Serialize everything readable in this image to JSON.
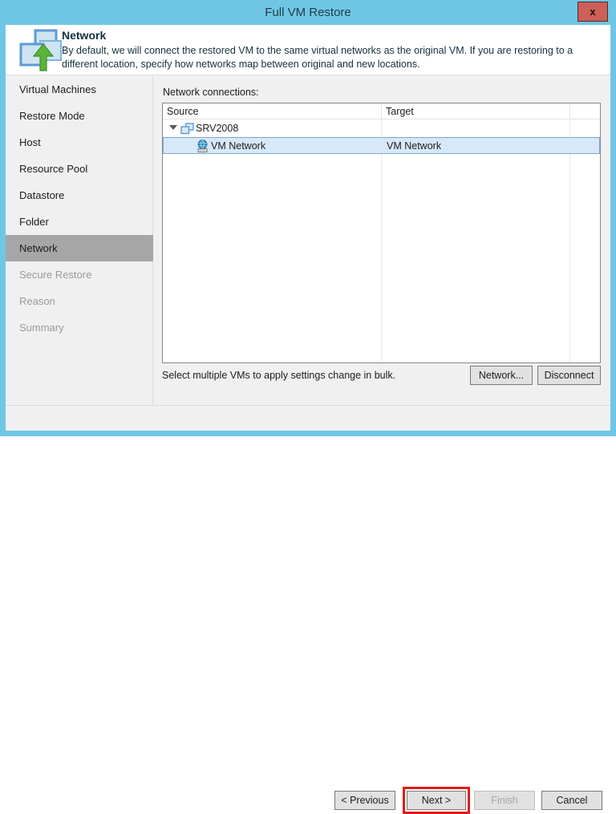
{
  "window": {
    "title": "Full VM Restore",
    "close_label": "x"
  },
  "banner": {
    "title": "Network",
    "description": "By default, we will connect the restored VM to the same virtual networks as the original VM. If you are restoring to a different location, specify how networks map between original and new locations.",
    "icon": "network-restore-icon"
  },
  "sidebar": {
    "items": [
      {
        "label": "Virtual Machines",
        "state": "normal"
      },
      {
        "label": "Restore Mode",
        "state": "normal"
      },
      {
        "label": "Host",
        "state": "normal"
      },
      {
        "label": "Resource Pool",
        "state": "normal"
      },
      {
        "label": "Datastore",
        "state": "normal"
      },
      {
        "label": "Folder",
        "state": "normal"
      },
      {
        "label": "Network",
        "state": "selected"
      },
      {
        "label": "Secure Restore",
        "state": "disabled"
      },
      {
        "label": "Reason",
        "state": "disabled"
      },
      {
        "label": "Summary",
        "state": "disabled"
      }
    ]
  },
  "main": {
    "list_label": "Network connections:",
    "columns": [
      {
        "label": "Source"
      },
      {
        "label": "Target"
      },
      {
        "label": ""
      }
    ],
    "rows": [
      {
        "type": "group",
        "icon": "virtual-machine-icon",
        "source": "SRV2008",
        "target": "",
        "expanded": true
      },
      {
        "type": "child",
        "icon": "network-adapter-icon",
        "source": "VM Network",
        "target": "VM Network",
        "selected": true
      }
    ],
    "bulk_hint": "Select multiple VMs to apply settings change in bulk.",
    "buttons": {
      "network": "Network...",
      "disconnect": "Disconnect"
    }
  },
  "footer": {
    "previous": "< Previous",
    "next": "Next >",
    "finish": "Finish",
    "cancel": "Cancel",
    "finish_enabled": false,
    "next_highlighted": true
  },
  "colors": {
    "window_chrome": "#6fc6e4",
    "close_button": "#cd6058",
    "sidebar_selected": "#a6a6a6",
    "row_selected_bg": "#d7e9f8",
    "row_selected_border": "#7aa7d4",
    "highlight_outline": "#e01b1b",
    "icon_blue": "#5b9bd5",
    "icon_green": "#5cb33a"
  }
}
